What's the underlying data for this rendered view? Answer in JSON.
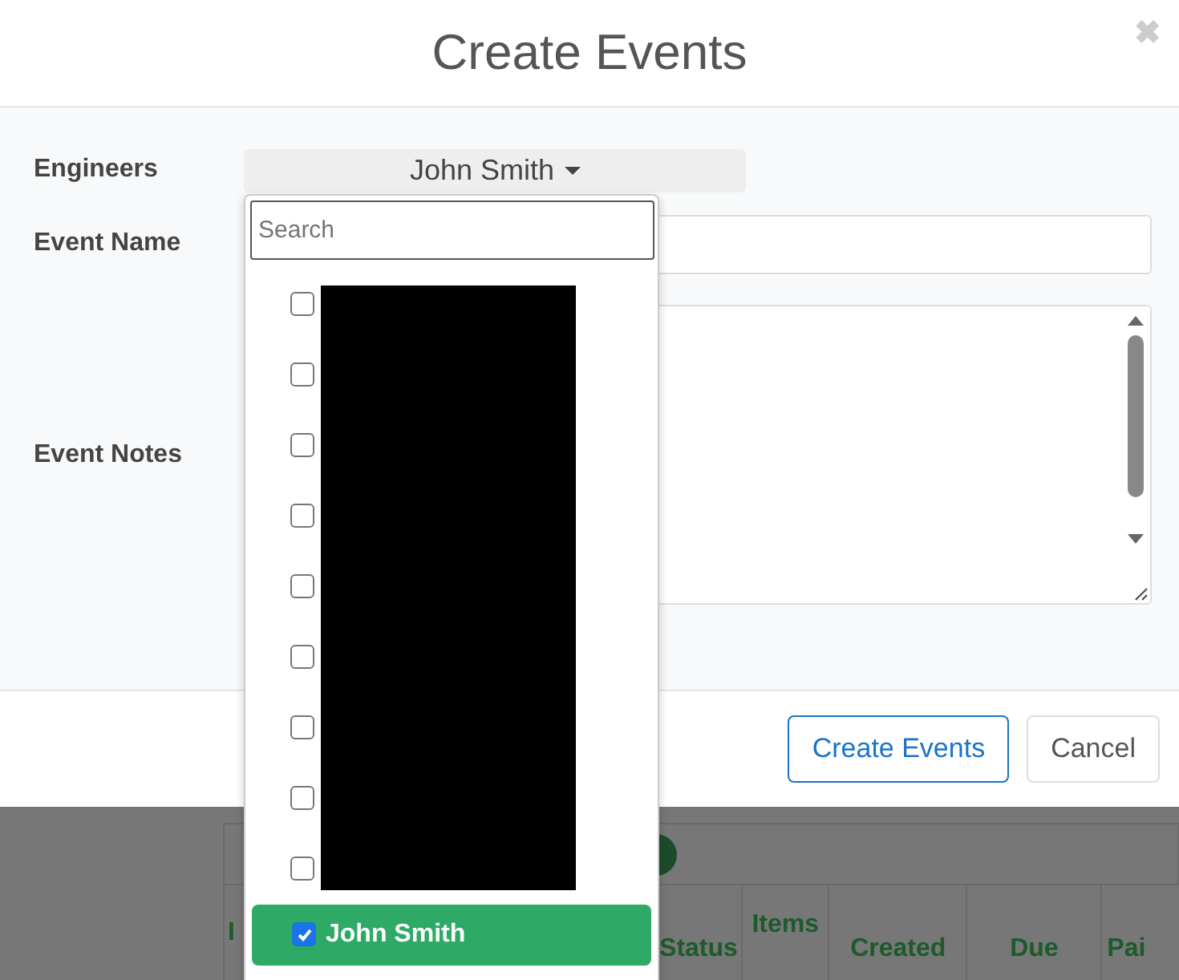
{
  "dialog": {
    "title": "Create Events",
    "close": "✖"
  },
  "form": {
    "engineers": {
      "label": "Engineers",
      "value": "John Smith",
      "expanded": true,
      "search": {
        "placeholder": "Search"
      },
      "redacted": true,
      "options": [
        {
          "checked": false
        },
        {
          "checked": false
        },
        {
          "checked": false
        },
        {
          "checked": false
        },
        {
          "checked": false
        },
        {
          "checked": false
        },
        {
          "checked": false
        },
        {
          "checked": false
        },
        {
          "checked": false
        },
        {
          "label": "John Smith",
          "checked": true
        }
      ]
    },
    "event_name": {
      "label": "Event Name"
    },
    "event_notes": {
      "label": "Event Notes"
    }
  },
  "buttons": [
    {
      "label": "Create Events",
      "kind": "primary"
    },
    {
      "label": "Cancel",
      "kind": "default"
    }
  ],
  "background_table": {
    "columns": [
      "I",
      "Status",
      "Items",
      "Created",
      "Due",
      "Pai"
    ]
  }
}
